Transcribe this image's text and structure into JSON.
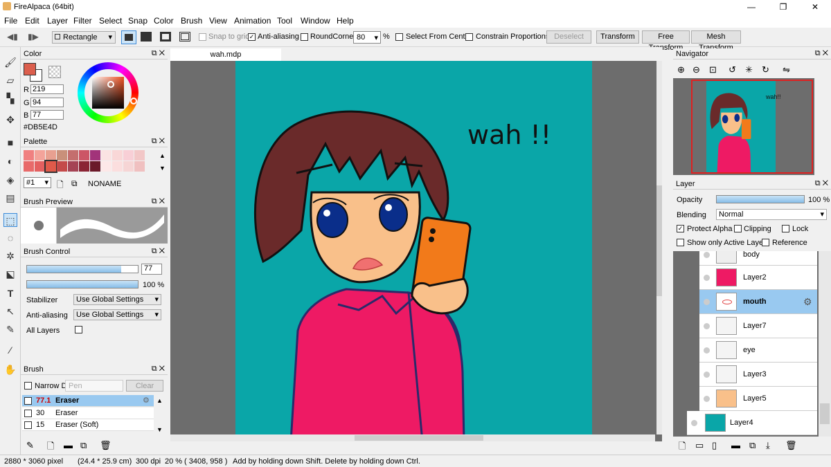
{
  "app": {
    "title": "FireAlpaca (64bit)"
  },
  "menu": [
    "File",
    "Edit",
    "Layer",
    "Filter",
    "Select",
    "Snap",
    "Color",
    "Brush",
    "View",
    "Animation",
    "Tool",
    "Window",
    "Help"
  ],
  "toolbar": {
    "shape": "Rectangle",
    "snap_grid": "Snap to grid",
    "antialias": "Anti-aliasing",
    "roundcorner": "RoundCorner",
    "round_value": "80",
    "percent": "%",
    "select_center": "Select From Center",
    "constrain": "Constrain Proportions",
    "deselect": "Deselect",
    "transform": "Transform",
    "free_transform": "Free Transform",
    "mesh_transform": "Mesh Transform"
  },
  "document": {
    "tab": "wah.mdp",
    "text": "wah !!"
  },
  "color_panel": {
    "title": "Color",
    "r_label": "R",
    "r": "219",
    "g_label": "G",
    "g": "94",
    "b_label": "B",
    "b": "77",
    "hex": "#DB5E4D",
    "current": "#db5e4d"
  },
  "palette_panel": {
    "title": "Palette",
    "index": "#1",
    "name": "NONAME",
    "colors": [
      "#f08080",
      "#f3a39a",
      "#e8a090",
      "#c9907a",
      "#c46e6e",
      "#cc5566",
      "#a2337a",
      "#fbe3e3",
      "#f9d7d7",
      "#f8cfd6",
      "#f2c7c7",
      "#e86a6a",
      "#e46060",
      "#e05a4a",
      "#c44a4a",
      "#a54455",
      "#8b2535",
      "#6b1a2a",
      "#fde8e8",
      "#fbdede",
      "#f6d5d5",
      "#f0c0c0"
    ]
  },
  "brush_preview": {
    "title": "Brush Preview"
  },
  "brush_control": {
    "title": "Brush Control",
    "size": "77",
    "opacity": "100 %",
    "stabilizer_label": "Stabilizer",
    "stabilizer": "Use Global Settings",
    "antialias_label": "Anti-aliasing",
    "antialias": "Use Global Settings",
    "all_layers": "All Layers",
    "size_fraction": 0.85,
    "opacity_fraction": 1.0
  },
  "brush_panel": {
    "title": "Brush",
    "narrow": "Narrow D",
    "search_placeholder": "Pen",
    "clear": "Clear",
    "items": [
      {
        "size": "77.1",
        "name": "Eraser"
      },
      {
        "size": "30",
        "name": "Eraser"
      },
      {
        "size": "15",
        "name": "Eraser (Soft)"
      }
    ]
  },
  "navigator": {
    "title": "Navigator",
    "preview_text": "wah!!"
  },
  "layer_panel": {
    "title": "Layer",
    "opacity_label": "Opacity",
    "opacity": "100 %",
    "opacity_fraction": 1.0,
    "blending_label": "Blending",
    "blending": "Normal",
    "protect_alpha": "Protect Alpha",
    "clipping": "Clipping",
    "lock": "Lock",
    "show_active": "Show only Active Layer",
    "reference": "Reference",
    "layers": [
      "body",
      "Layer2",
      "mouth",
      "Layer7",
      "eye",
      "Layer3",
      "Layer5",
      "Layer4"
    ]
  },
  "status": {
    "size": "2880 * 3060 pixel",
    "cm": "(24.4 * 25.9 cm)",
    "dpi": "300 dpi",
    "zoom": "20 %",
    "coords": "( 3408, 958 )",
    "hint": "Add by holding down Shift. Delete by holding down Ctrl."
  }
}
